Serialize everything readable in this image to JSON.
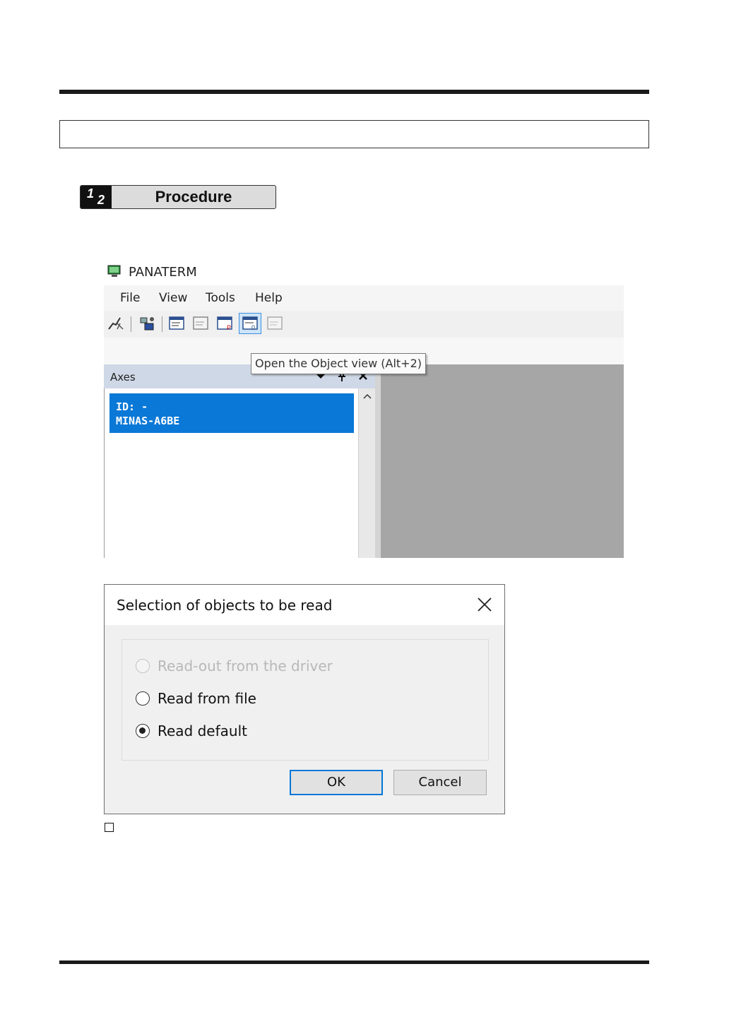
{
  "procedure": {
    "badge_num1": "1",
    "badge_num2": "2",
    "title": "Procedure"
  },
  "panaterm": {
    "title": "PANATERM",
    "menu": [
      "File",
      "View",
      "Tools",
      "Help"
    ],
    "toolbar_icons": [
      "connect-icon",
      "communication-icon",
      "parameter-icon",
      "monitor-icon",
      "parameter-print-icon",
      "object-view-icon",
      "disabled-view-icon"
    ],
    "tooltip": "Open the Object view (Alt+2)",
    "axes_panel": {
      "title": "Axes",
      "item": {
        "line1": "ID: -",
        "line2": "MINAS-A6BE"
      }
    },
    "colors": {
      "selection": "#0a78d7",
      "panel_header": "#cfd8e6",
      "workspace": "#a6a6a6"
    }
  },
  "dialog": {
    "title": "Selection of objects to be read",
    "options": [
      {
        "label": "Read-out from the driver",
        "enabled": false,
        "selected": false
      },
      {
        "label": "Read from file",
        "enabled": true,
        "selected": false
      },
      {
        "label": "Read default",
        "enabled": true,
        "selected": true
      }
    ],
    "ok_label": "OK",
    "cancel_label": "Cancel",
    "colors": {
      "default_button_border": "#0078d7"
    }
  }
}
